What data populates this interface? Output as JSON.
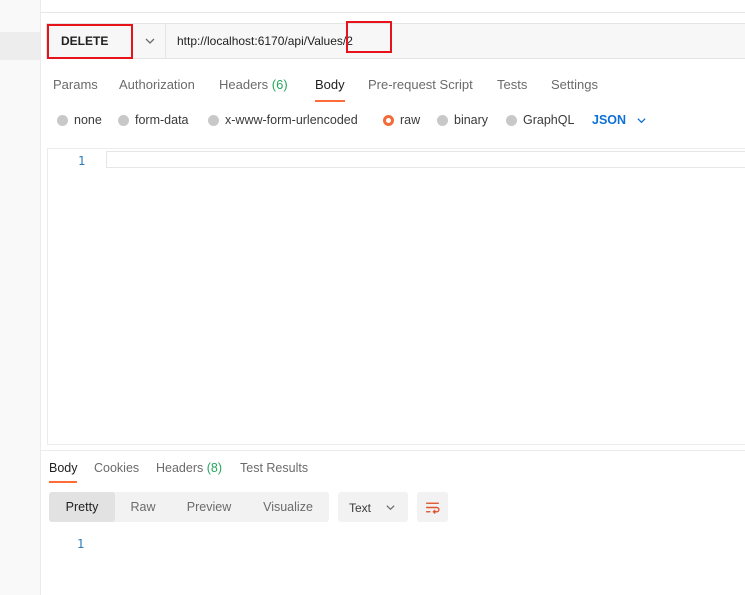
{
  "request": {
    "method": "DELETE",
    "url": "http://localhost:6170/api/Values/2"
  },
  "request_tabs": [
    {
      "label": "Params"
    },
    {
      "label": "Authorization"
    },
    {
      "label": "Headers",
      "count": "(6)"
    },
    {
      "label": "Body",
      "active": true
    },
    {
      "label": "Pre-request Script"
    },
    {
      "label": "Tests"
    },
    {
      "label": "Settings"
    }
  ],
  "body_types": [
    {
      "label": "none"
    },
    {
      "label": "form-data"
    },
    {
      "label": "x-www-form-urlencoded"
    },
    {
      "label": "raw",
      "selected": true
    },
    {
      "label": "binary"
    },
    {
      "label": "GraphQL"
    }
  ],
  "body_format": "JSON",
  "editor": {
    "line_number": "1"
  },
  "response_tabs": [
    {
      "label": "Body",
      "active": true
    },
    {
      "label": "Cookies"
    },
    {
      "label": "Headers",
      "count": "(8)"
    },
    {
      "label": "Test Results"
    }
  ],
  "response_views": [
    {
      "label": "Pretty",
      "active": true
    },
    {
      "label": "Raw"
    },
    {
      "label": "Preview"
    },
    {
      "label": "Visualize"
    }
  ],
  "response_format": "Text",
  "response_editor": {
    "line_number": "1"
  },
  "icons": {
    "method_dropdown": "chevron-down-icon",
    "format_dropdown": "chevron-down-icon",
    "wrap": "wrap-lines-icon"
  },
  "colors": {
    "accent": "#ff6c37",
    "highlight_box": "#e8121b",
    "json_link": "#0e6fd8",
    "count_green": "#26a65b"
  }
}
